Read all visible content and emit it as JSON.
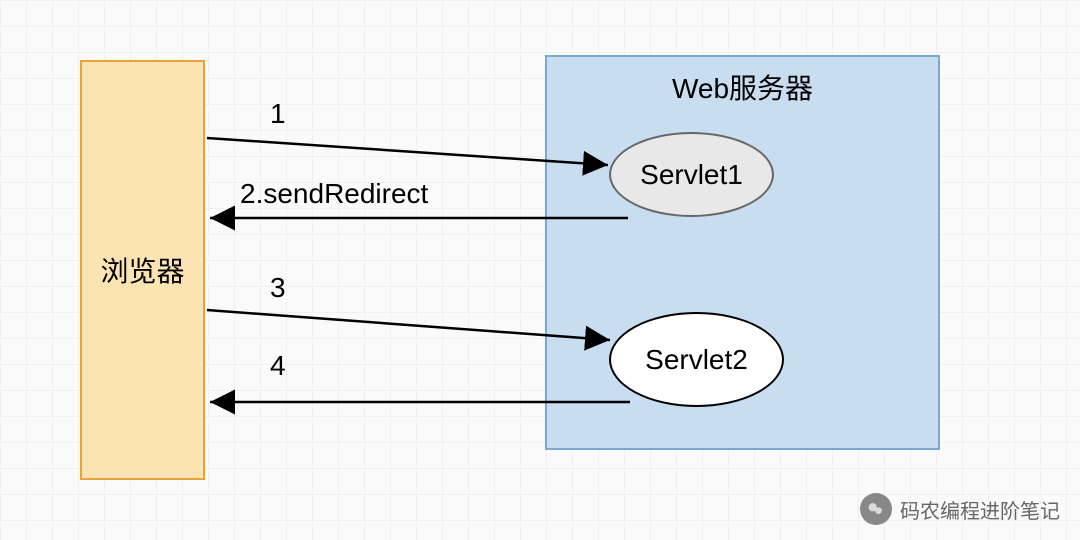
{
  "browser": {
    "label": "浏览器"
  },
  "server": {
    "title": "Web服务器",
    "servlet1": "Servlet1",
    "servlet2": "Servlet2"
  },
  "arrows": {
    "a1": "1",
    "a2": "2.sendRedirect",
    "a3": "3",
    "a4": "4"
  },
  "watermark": "码农编程进阶笔记"
}
